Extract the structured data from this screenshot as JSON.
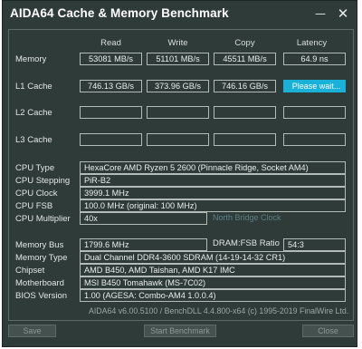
{
  "window": {
    "title": "AIDA64 Cache & Memory Benchmark",
    "minimize_glyph": "—",
    "close_glyph": "✕"
  },
  "columns": [
    "Read",
    "Write",
    "Copy",
    "Latency"
  ],
  "rows": [
    {
      "label": "Memory",
      "read": "53081 MB/s",
      "write": "51101 MB/s",
      "copy": "45511 MB/s",
      "latency": "64.9 ns"
    },
    {
      "label": "L1 Cache",
      "read": "746.13 GB/s",
      "write": "373.96 GB/s",
      "copy": "746.16 GB/s",
      "latency": ""
    },
    {
      "label": "L2 Cache",
      "read": "",
      "write": "",
      "copy": "",
      "latency": ""
    },
    {
      "label": "L3 Cache",
      "read": "",
      "write": "",
      "copy": "",
      "latency": ""
    }
  ],
  "wait_button": "Please wait...",
  "cpu": {
    "type_label": "CPU Type",
    "type": "HexaCore AMD Ryzen 5 2600  (Pinnacle Ridge, Socket AM4)",
    "stepping_label": "CPU Stepping",
    "stepping": "PiR-B2",
    "clock_label": "CPU Clock",
    "clock": "3999.1 MHz",
    "fsb_label": "CPU FSB",
    "fsb": "100.0 MHz  (original: 100 MHz)",
    "multiplier_label": "CPU Multiplier",
    "multiplier": "40x",
    "nb_clock_label": "North Bridge Clock"
  },
  "memory": {
    "bus_label": "Memory Bus",
    "bus": "1799.6 MHz",
    "dram_ratio_label": "DRAM:FSB Ratio",
    "dram_ratio": "54:3",
    "type_label": "Memory Type",
    "type": "Dual Channel DDR4-3600 SDRAM  (14-19-14-32 CR1)",
    "chipset_label": "Chipset",
    "chipset": "AMD B450, AMD Taishan, AMD K17 IMC",
    "motherboard_label": "Motherboard",
    "motherboard": "MSI B450 Tomahawk (MS-7C02)",
    "bios_label": "BIOS Version",
    "bios": "1.00  (AGESA: Combo-AM4 1.0.0.4)"
  },
  "footer": "AIDA64 v6.00.5100 / BenchDLL 4.4.800-x64  (c) 1995-2019 FinalWire Ltd.",
  "buttons": {
    "save": "Save",
    "start": "Start Benchmark",
    "close": "Close"
  }
}
